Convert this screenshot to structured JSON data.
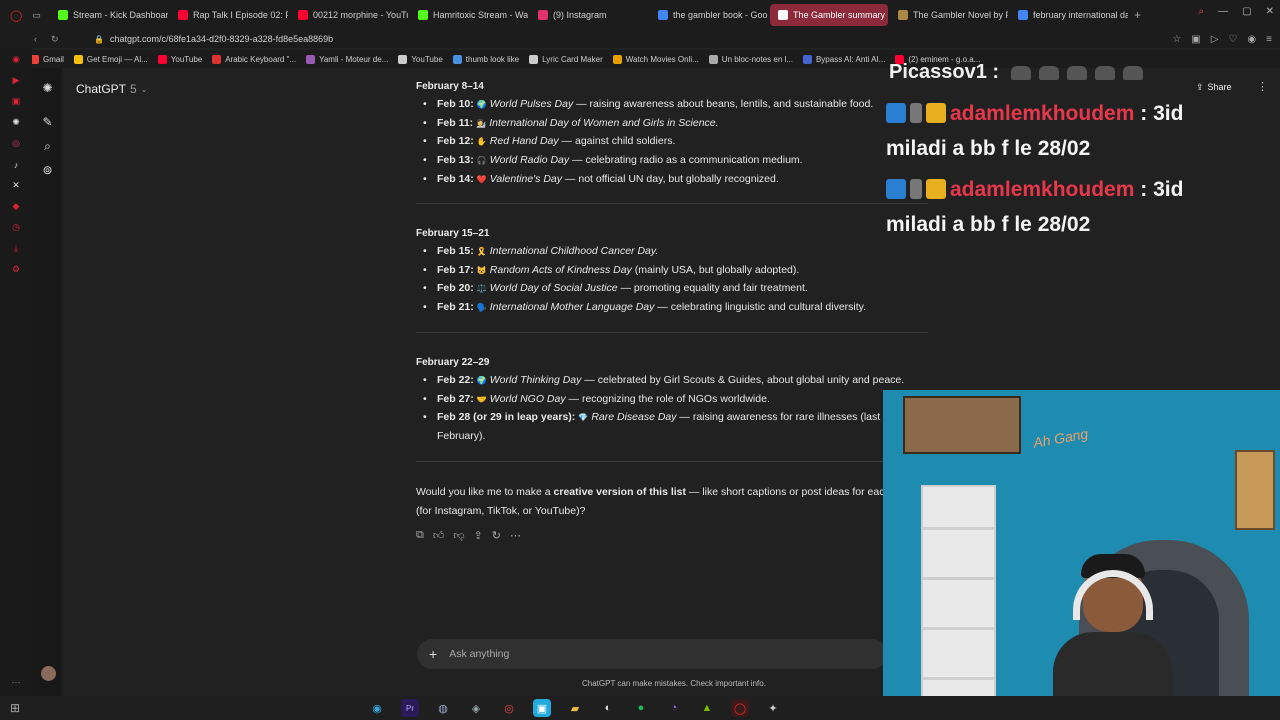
{
  "browser": {
    "tabs": [
      {
        "label": "Stream - Kick Dashboard",
        "color": "#53fc18"
      },
      {
        "label": "Rap Talk I Episode 02: F",
        "color": "#ff0033"
      },
      {
        "label": "00212 morphine - YouTu",
        "color": "#ff0033"
      },
      {
        "label": "Hamritoxic Stream - Wa",
        "color": "#53fc18"
      },
      {
        "label": "(9) Instagram",
        "color": "#e1306c"
      },
      {
        "label": "the gambler book - Goo",
        "color": "#4285f4"
      },
      {
        "label": "The Gambler summary",
        "color": "#ffffff",
        "active": true
      },
      {
        "label": "The Gambler Novel by F",
        "color": "#aa8844"
      },
      {
        "label": "february international da",
        "color": "#4285f4"
      }
    ],
    "url": "chatgpt.com/c/68fe1a34-d2f0-8329-a328-fd8e5ea8869b",
    "bookmarks": [
      "Gmail",
      "Get Emoji — Al...",
      "YouTube",
      "Arabic Keyboard \"...",
      "Yamli - Moteur de...",
      "YouTube",
      "thumb look like",
      "Lyric Card Maker",
      "Watch Movies Onli...",
      "Un bloc-notes en l...",
      "Bypass AI: Anti AI...",
      "(2) eminem - g.o.a..."
    ]
  },
  "chatgpt": {
    "model_name": "ChatGPT",
    "model_version": "5",
    "share_label": "Share",
    "sections": [
      {
        "heading": "February 8–14",
        "items": [
          {
            "date": "Feb 10:",
            "emoji": "🌍",
            "name": "World Pulses Day",
            "rest": " — raising awareness about beans, lentils, and sustainable food."
          },
          {
            "date": "Feb 11:",
            "emoji": "👩‍🔬",
            "name": "International Day of Women and Girls in Science.",
            "rest": ""
          },
          {
            "date": "Feb 12:",
            "emoji": "✋",
            "name": "Red Hand Day",
            "rest": " — against child soldiers."
          },
          {
            "date": "Feb 13:",
            "emoji": "🎧",
            "name": "World Radio Day",
            "rest": " — celebrating radio as a communication medium."
          },
          {
            "date": "Feb 14:",
            "emoji": "❤️",
            "name": "Valentine's Day",
            "rest": " — not official UN day, but globally recognized."
          }
        ]
      },
      {
        "heading": "February 15–21",
        "items": [
          {
            "date": "Feb 15:",
            "emoji": "🎗️",
            "name": "International Childhood Cancer Day.",
            "rest": ""
          },
          {
            "date": "Feb 17:",
            "emoji": "😺",
            "name": "Random Acts of Kindness Day",
            "rest": " (mainly USA, but globally adopted)."
          },
          {
            "date": "Feb 20:",
            "emoji": "⚖️",
            "name": "World Day of Social Justice",
            "rest": " — promoting equality and fair treatment."
          },
          {
            "date": "Feb 21:",
            "emoji": "🗣️",
            "name": "International Mother Language Day",
            "rest": " — celebrating linguistic and cultural diversity."
          }
        ]
      },
      {
        "heading": "February 22–29",
        "items": [
          {
            "date": "Feb 22:",
            "emoji": "🌍",
            "name": "World Thinking Day",
            "rest": " — celebrated by Girl Scouts & Guides, about global unity and peace."
          },
          {
            "date": "Feb 27:",
            "emoji": "🤝",
            "name": "World NGO Day",
            "rest": " — recognizing the role of NGOs worldwide."
          },
          {
            "date": "Feb 28 (or 29 in leap years):",
            "emoji": "💎",
            "name": "Rare Disease Day",
            "rest": " — raising awareness for rare illnesses (last d",
            "cont": "February)."
          }
        ]
      }
    ],
    "question_pre": "Would you like me to make a ",
    "question_bold": "creative version of this list",
    "question_post": " — like short captions or post ideas for eac",
    "question_line2": "(for Instagram, TikTok, or YouTube)?",
    "composer_placeholder": "Ask anything",
    "footer": "ChatGPT can make mistakes. Check important info."
  },
  "stream_overlay": {
    "streamer": "Picassov1 :",
    "messages": [
      {
        "user": "adamlemkhoudem",
        "sep": " : ",
        "text1": "3id",
        "text2": "miladi a bb f le 28/02"
      },
      {
        "user": "adamlemkhoudem",
        "sep": " : ",
        "text1": "3id",
        "text2": "miladi a bb f le 28/02"
      }
    ],
    "webcam_sign": "Ah Gang"
  }
}
